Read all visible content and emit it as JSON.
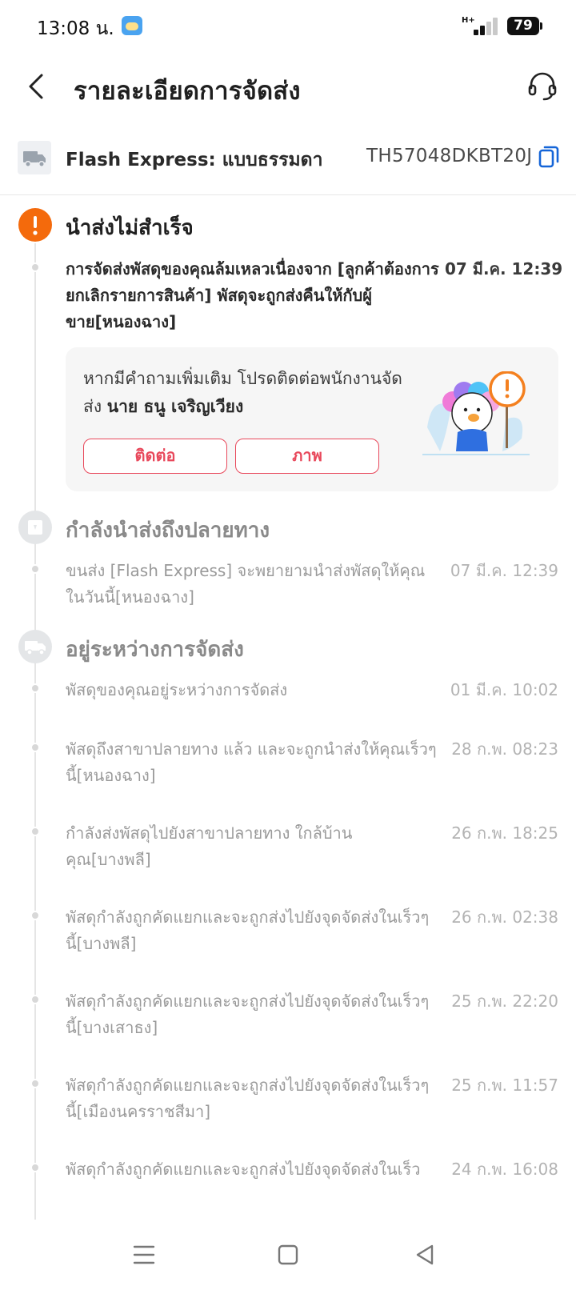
{
  "status_bar": {
    "time": "13:08 น.",
    "network": "H+",
    "battery": "79"
  },
  "header": {
    "title": "รายละเอียดการจัดส่ง"
  },
  "carrier": {
    "name": "Flash Express: แบบธรรมดา",
    "tracking_number": "TH57048DKBT20J"
  },
  "colors": {
    "accent": "#e8485b",
    "alert": "#f46a0c"
  },
  "stages": [
    {
      "title": "นำส่งไม่สำเร็จ",
      "icon": "alert-icon",
      "events": [
        {
          "text": "การจัดส่งพัสดุของคุณล้มเหลวเนื่องจาก [ลูกค้าต้องการยกเลิกรายการสินค้า] พัสดุจะถูกส่งคืนให้กับผู้ขาย[หนองฉาง]",
          "time": "07 มี.ค. 12:39"
        }
      ],
      "contact": {
        "text": "หากมีคำถามเพิ่มเติม โปรดติดต่อพนักงานจัดส่ง",
        "courier_name": "นาย ธนู เจริญเวียง",
        "contact_label": "ติดต่อ",
        "photo_label": "ภาพ"
      }
    },
    {
      "title": "กำลังนำส่งถึงปลายทาง",
      "icon": "parcel-icon",
      "events": [
        {
          "text": "ขนส่ง [Flash Express] จะพยายามนำส่งพัสดุให้คุณในวันนี้[หนองฉาง]",
          "time": "07 มี.ค. 12:39"
        }
      ]
    },
    {
      "title": "อยู่ระหว่างการจัดส่ง",
      "icon": "truck-icon",
      "events": [
        {
          "text": "พัสดุของคุณอยู่ระหว่างการจัดส่ง",
          "time": "01 มี.ค. 10:02"
        },
        {
          "text": "พัสดุถึงสาขาปลายทาง แล้ว และจะถูกนำส่งให้คุณเร็วๆ นี้[หนองฉาง]",
          "time": "28 ก.พ. 08:23"
        },
        {
          "text": "กำลังส่งพัสดุไปยังสาขาปลายทาง ใกล้บ้านคุณ[บางพลี]",
          "time": "26 ก.พ. 18:25"
        },
        {
          "text": "พัสดุกำลังถูกคัดแยกและจะถูกส่งไปยังจุดจัดส่งในเร็วๆ นี้[บางพลี]",
          "time": "26 ก.พ. 02:38"
        },
        {
          "text": "พัสดุกำลังถูกคัดแยกและจะถูกส่งไปยังจุดจัดส่งในเร็วๆ นี้[บางเสาธง]",
          "time": "25 ก.พ. 22:20"
        },
        {
          "text": "พัสดุกำลังถูกคัดแยกและจะถูกส่งไปยังจุดจัดส่งในเร็วๆ นี้[เมืองนครราชสีมา]",
          "time": "25 ก.พ. 11:57"
        },
        {
          "text": "พัสดุกำลังถูกคัดแยกและจะถูกส่งไปยังจุดจัดส่งในเร็ว",
          "time": "24 ก.พ. 16:08"
        }
      ]
    }
  ],
  "nav_bar": {
    "icons": [
      "menu-icon",
      "home-icon",
      "back-triangle-icon"
    ]
  }
}
